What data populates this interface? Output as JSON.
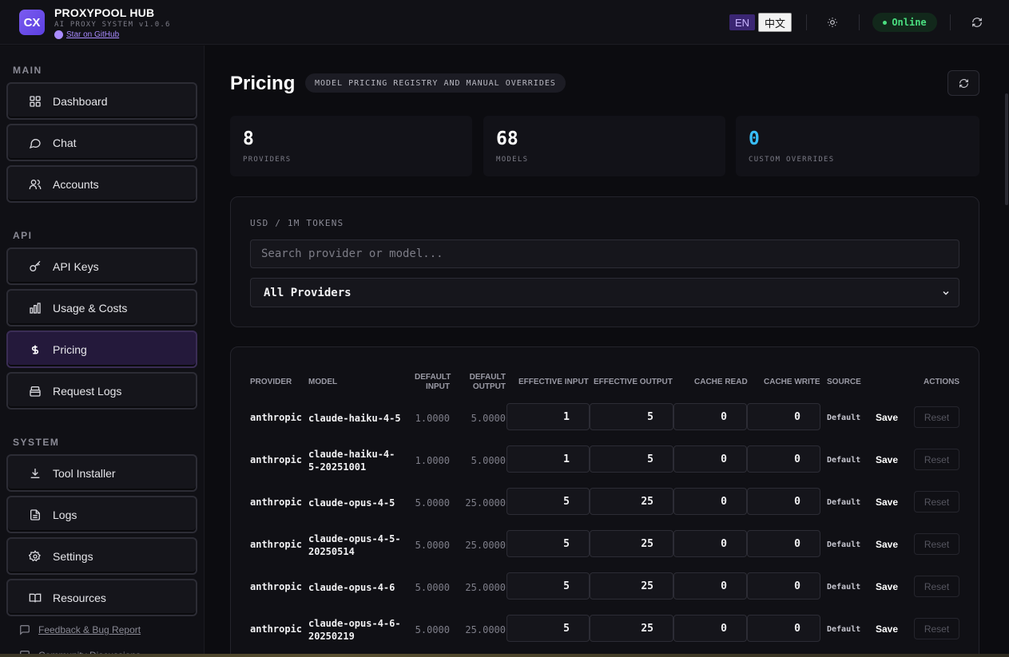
{
  "header": {
    "logo_text": "CX",
    "app_name": "PROXYPOOL HUB",
    "app_subtitle": "AI PROXY SYSTEM v1.0.6",
    "github_link": "Star on GitHub",
    "lang_en": "EN",
    "lang_zh": "中文",
    "status": "Online",
    "accent_color": "#7b5cf0",
    "status_color": "#4ade80"
  },
  "sidebar": {
    "sections": [
      {
        "title": "MAIN",
        "items": [
          {
            "label": "Dashboard",
            "icon": "grid-icon"
          },
          {
            "label": "Chat",
            "icon": "chat-bubble-icon"
          },
          {
            "label": "Accounts",
            "icon": "users-icon"
          }
        ]
      },
      {
        "title": "API",
        "items": [
          {
            "label": "API Keys",
            "icon": "key-icon"
          },
          {
            "label": "Usage & Costs",
            "icon": "bar-chart-icon"
          },
          {
            "label": "Pricing",
            "icon": "dollar-icon",
            "active": true
          },
          {
            "label": "Request Logs",
            "icon": "archive-icon"
          }
        ]
      },
      {
        "title": "SYSTEM",
        "items": [
          {
            "label": "Tool Installer",
            "icon": "download-icon"
          },
          {
            "label": "Logs",
            "icon": "file-icon"
          },
          {
            "label": "Settings",
            "icon": "gear-icon"
          },
          {
            "label": "Resources",
            "icon": "book-icon"
          }
        ]
      }
    ],
    "footer_links": [
      "Feedback & Bug Report",
      "Community Discussions"
    ]
  },
  "page": {
    "title": "Pricing",
    "subtitle": "MODEL PRICING REGISTRY AND MANUAL OVERRIDES"
  },
  "stats": [
    {
      "value": "8",
      "label": "PROVIDERS",
      "color": "#ffffff"
    },
    {
      "value": "68",
      "label": "MODELS",
      "color": "#ffffff"
    },
    {
      "value": "0",
      "label": "CUSTOM OVERRIDES",
      "color": "#38bdf8"
    }
  ],
  "filters": {
    "unit_label": "USD / 1M TOKENS",
    "search_placeholder": "Search provider or model...",
    "search_value": "",
    "provider_select": "All Providers"
  },
  "table": {
    "headers": {
      "provider": "PROVIDER",
      "model": "MODEL",
      "default_input_1": "DEFAULT",
      "default_input_2": "INPUT",
      "default_output_1": "DEFAULT",
      "default_output_2": "OUTPUT",
      "effective_input": "EFFECTIVE INPUT",
      "effective_output": "EFFECTIVE OUTPUT",
      "cache_read": "CACHE READ",
      "cache_write": "CACHE WRITE",
      "source": "SOURCE",
      "actions": "ACTIONS"
    },
    "save_label": "Save",
    "reset_label": "Reset",
    "rows": [
      {
        "provider": "anthropic",
        "model": "claude-haiku-4-5",
        "default_input": "1.0000",
        "default_output": "5.0000",
        "effective_input": "1",
        "effective_output": "5",
        "cache_read": "0",
        "cache_write": "0",
        "source": "Default"
      },
      {
        "provider": "anthropic",
        "model": "claude-haiku-4-5-20251001",
        "default_input": "1.0000",
        "default_output": "5.0000",
        "effective_input": "1",
        "effective_output": "5",
        "cache_read": "0",
        "cache_write": "0",
        "source": "Default"
      },
      {
        "provider": "anthropic",
        "model": "claude-opus-4-5",
        "default_input": "5.0000",
        "default_output": "25.0000",
        "effective_input": "5",
        "effective_output": "25",
        "cache_read": "0",
        "cache_write": "0",
        "source": "Default"
      },
      {
        "provider": "anthropic",
        "model": "claude-opus-4-5-20250514",
        "default_input": "5.0000",
        "default_output": "25.0000",
        "effective_input": "5",
        "effective_output": "25",
        "cache_read": "0",
        "cache_write": "0",
        "source": "Default"
      },
      {
        "provider": "anthropic",
        "model": "claude-opus-4-6",
        "default_input": "5.0000",
        "default_output": "25.0000",
        "effective_input": "5",
        "effective_output": "25",
        "cache_read": "0",
        "cache_write": "0",
        "source": "Default"
      },
      {
        "provider": "anthropic",
        "model": "claude-opus-4-6-20250219",
        "default_input": "5.0000",
        "default_output": "25.0000",
        "effective_input": "5",
        "effective_output": "25",
        "cache_read": "0",
        "cache_write": "0",
        "source": "Default"
      }
    ]
  }
}
